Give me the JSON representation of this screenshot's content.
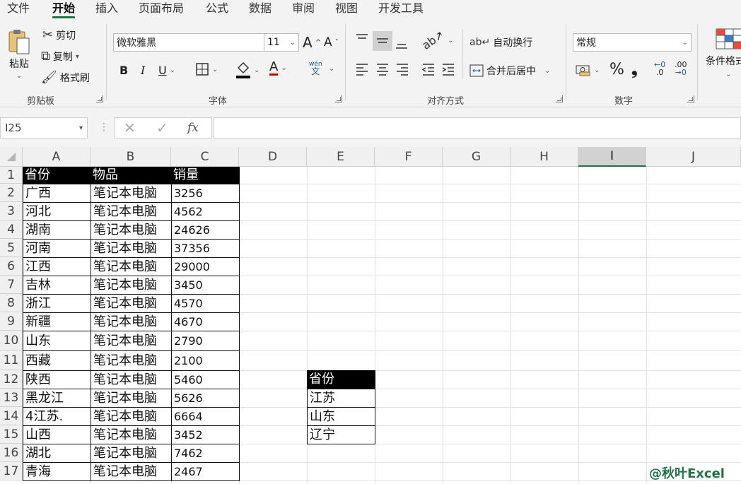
{
  "menu": {
    "tabs": [
      "文件",
      "开始",
      "插入",
      "页面布局",
      "公式",
      "数据",
      "审阅",
      "视图",
      "开发工具"
    ],
    "active": "开始"
  },
  "ribbon": {
    "clipboard": {
      "paste": "粘贴",
      "cut": "剪切",
      "copy": "复制",
      "format_painter": "格式刷",
      "label": "剪贴板"
    },
    "font": {
      "name": "微软雅黑",
      "size": "11",
      "bold": "B",
      "italic": "I",
      "underline": "U",
      "grow": "A",
      "shrink": "A",
      "color_a": "A",
      "pinyin_top": "wén",
      "pinyin_bottom": "文",
      "label": "字体"
    },
    "alignment": {
      "wrap": "自动换行",
      "merge": "合并后居中",
      "label": "对齐方式"
    },
    "number": {
      "format": "常规",
      "percent": "%",
      "comma": "❟",
      "inc_decimal": ".0",
      "dec_decimal": ".00",
      "label": "数字"
    },
    "styles": {
      "conditional": "条件格式"
    }
  },
  "formula_bar": {
    "name_box": "I25",
    "fx": "fx",
    "value": ""
  },
  "sheet": {
    "columns": [
      "A",
      "B",
      "C",
      "D",
      "E",
      "F",
      "G",
      "H",
      "I",
      "J"
    ],
    "selected_column": "I",
    "rows": [
      "1",
      "2",
      "3",
      "4",
      "5",
      "6",
      "7",
      "8",
      "9",
      "10",
      "11",
      "12",
      "13",
      "14",
      "15",
      "16",
      "17"
    ],
    "table_headers": [
      "省份",
      "物品",
      "销量"
    ],
    "table_rows": [
      [
        "广西",
        "笔记本电脑",
        "3256"
      ],
      [
        "河北",
        "笔记本电脑",
        "4562"
      ],
      [
        "湖南",
        "笔记本电脑",
        "24626"
      ],
      [
        "河南",
        "笔记本电脑",
        "37356"
      ],
      [
        "江西",
        "笔记本电脑",
        "29000"
      ],
      [
        "吉林",
        "笔记本电脑",
        "3450"
      ],
      [
        "浙江",
        "笔记本电脑",
        "4570"
      ],
      [
        "新疆",
        "笔记本电脑",
        "4670"
      ],
      [
        "山东",
        "笔记本电脑",
        "2790"
      ],
      [
        "西藏",
        "笔记本电脑",
        "2100"
      ],
      [
        "陕西",
        "笔记本电脑",
        "5460"
      ],
      [
        "黑龙江",
        "笔记本电脑",
        "5626"
      ],
      [
        "4江苏.",
        "笔记本电脑",
        "6664"
      ],
      [
        "山西",
        "笔记本电脑",
        "3452"
      ],
      [
        "湖北",
        "笔记本电脑",
        "7462"
      ],
      [
        "青海",
        "笔记本电脑",
        "2467"
      ]
    ],
    "filter_header": "省份",
    "filter_values": [
      "江苏",
      "山东",
      "辽宁"
    ]
  },
  "watermark": "@秋叶Excel",
  "colors": {
    "accent": "#217346",
    "header_fill": "#000000"
  }
}
